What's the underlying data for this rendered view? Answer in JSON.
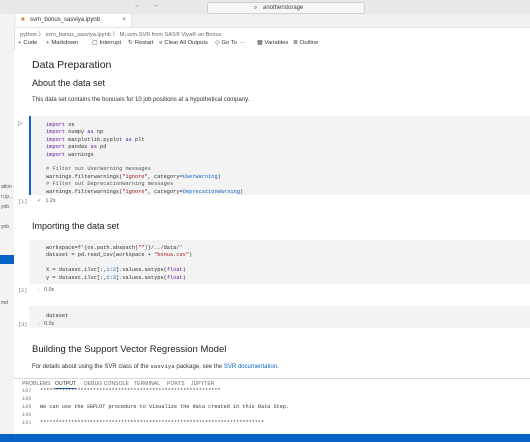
{
  "titlebar": {
    "search_text": "anotherstorage",
    "back": "←",
    "forward": "→"
  },
  "sidebar_peek": [
    "ation",
    "n.ip...",
    "ynb",
    "ynb",
    "md"
  ],
  "tab": {
    "name": "svm_bonus_sasviya.ipynb",
    "close": "×"
  },
  "breadcrumb": "python 〉 svm_bonus_sasviya.ipynb 〉 M↓svm.SVR from SAS® Viya® on Bonus",
  "toolbar": {
    "code": "Code",
    "markdown": "Markdown",
    "interrupt": "Interrupt",
    "restart": "Restart",
    "clear": "Clear All Outputs",
    "goto": "Go To",
    "variables": "Variables",
    "outline": "Outline",
    "more": "···"
  },
  "headings": {
    "data_prep": "Data Preparation",
    "about": "About the data set",
    "importing": "Importing the data set",
    "svr": "Building the Support Vector Regression Model"
  },
  "text": {
    "about_desc": "This data set contains the bonuses for 10 job positions at a hypothetical company.",
    "svr_pre": "For details about using the SVR class of the ",
    "svr_pkg": "sasviya",
    "svr_mid": " package, see the ",
    "svr_link": "SVR documentation",
    "svr_post": "."
  },
  "cells": [
    {
      "exec": "[1]",
      "status": "1.2s"
    },
    {
      "exec": "[2]",
      "status": "0.0s"
    },
    {
      "exec": "[3]",
      "status": "0.0s",
      "code": "dataset"
    }
  ],
  "panel": {
    "problems": "PROBLEMS",
    "output": "OUTPUT",
    "debug": "DEBUG CONSOLE",
    "terminal": "TERMINAL",
    "ports": "PORTS",
    "jupyter": "JUPYTER"
  },
  "output_lines": [
    {
      "n": "187",
      "t": "**********************************************************"
    },
    {
      "n": "188",
      "t": ""
    },
    {
      "n": "189",
      "t": "We can use the SGPLOT procedure to visualize the data created in this Data Step."
    },
    {
      "n": "190",
      "t": ""
    },
    {
      "n": "191",
      "t": "************************************************************************"
    }
  ],
  "colors": {
    "accent": "#0a64c8",
    "cell_bg": "#f3f3f3",
    "success": "#2e9c5a"
  }
}
